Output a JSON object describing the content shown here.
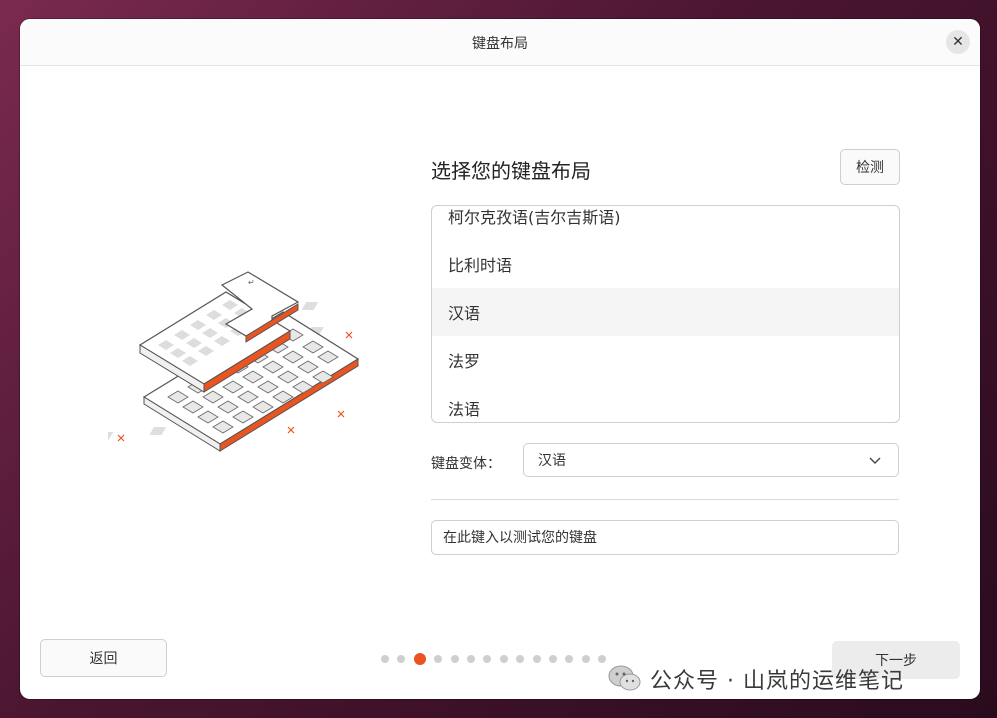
{
  "window": {
    "title": "键盘布局"
  },
  "main": {
    "heading": "选择您的键盘布局",
    "detect_label": "检测",
    "layouts": [
      {
        "label": "柯尔克孜语(吉尔吉斯语)"
      },
      {
        "label": "比利时语"
      },
      {
        "label": "汉语",
        "selected": true
      },
      {
        "label": "法罗"
      },
      {
        "label": "法语"
      }
    ],
    "variant": {
      "label": "键盘变体：",
      "value": "汉语"
    },
    "test": {
      "placeholder": "在此键入以测试您的键盘"
    }
  },
  "footer": {
    "back_label": "返回",
    "next_label": "下一步",
    "progress": {
      "total": 15,
      "current": 3
    }
  },
  "watermark": {
    "text": "公众号 · 山岚的运维笔记"
  },
  "colors": {
    "accent": "#e95420",
    "background": "#4a1530"
  }
}
